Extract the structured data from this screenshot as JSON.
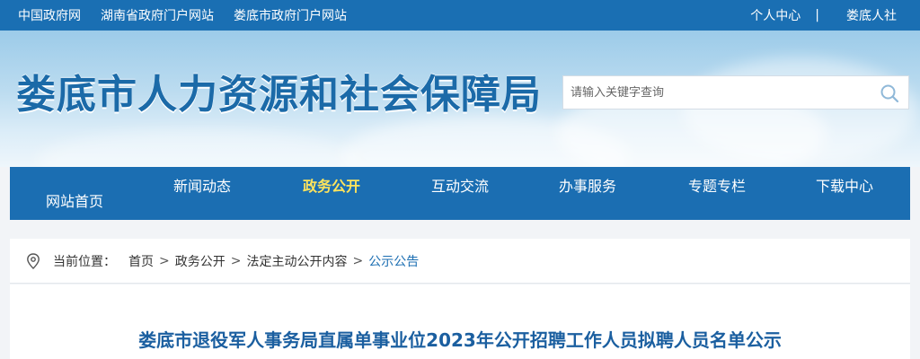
{
  "topbar": {
    "left_links": [
      "中国政府网",
      "湖南省政府门户网站",
      "娄底市政府门户网站"
    ],
    "personal_center": "个人中心",
    "separator": "|",
    "login_label": "娄底人社"
  },
  "header": {
    "site_title": "娄底市人力资源和社会保障局",
    "search_placeholder": "请输入关键字查询"
  },
  "nav": {
    "items": [
      {
        "label": "网站首页",
        "active": false
      },
      {
        "label": "新闻动态",
        "active": false
      },
      {
        "label": "政务公开",
        "active": true
      },
      {
        "label": "互动交流",
        "active": false
      },
      {
        "label": "办事服务",
        "active": false
      },
      {
        "label": "专题专栏",
        "active": false
      },
      {
        "label": "下载中心",
        "active": false
      }
    ]
  },
  "breadcrumb": {
    "label": "当前位置：",
    "items": [
      "首页",
      "政务公开",
      "法定主动公开内容",
      "公示公告"
    ],
    "sep": ">"
  },
  "article": {
    "title": "娄底市退役军人事务局直属单事业位2023年公开招聘工作人员拟聘人员名单公示"
  },
  "colors": {
    "topbar_bg": "#1a6fb3",
    "nav_bg": "#1b6eb2",
    "nav_active": "#ffe45c",
    "title_blue": "#1b6aa8"
  },
  "icons": {
    "search": "search-icon",
    "location": "location-pin-icon"
  }
}
